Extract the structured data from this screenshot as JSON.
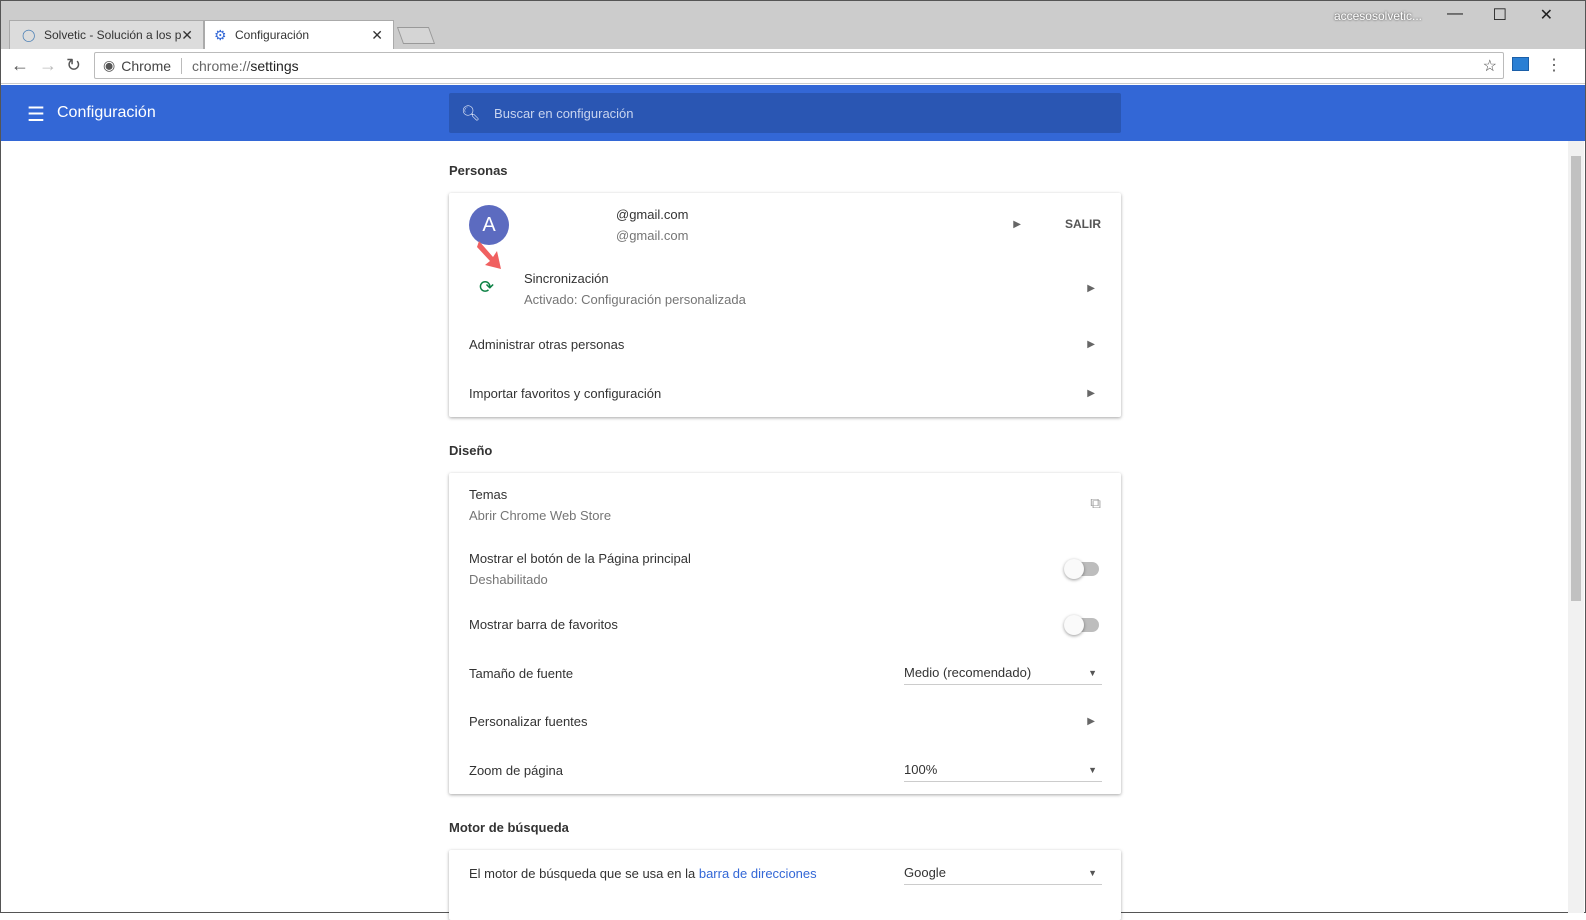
{
  "window": {
    "user": "accesosolvetic...",
    "minimize": "—",
    "maximize": "☐",
    "close": "✕"
  },
  "tabs": [
    {
      "label": "Solvetic - Solución a los p",
      "close": "✕"
    },
    {
      "label": "Configuración",
      "close": "✕"
    }
  ],
  "toolbar": {
    "chip": "Chrome",
    "url_scheme": "chrome://",
    "url_path": "settings"
  },
  "header": {
    "title": "Configuración",
    "search_placeholder": "Buscar en configuración"
  },
  "people": {
    "heading": "Personas",
    "avatar": "A",
    "name": "@gmail.com",
    "email": "@gmail.com",
    "signout": "SALIR",
    "sync_title": "Sincronización",
    "sync_status": "Activado: Configuración personalizada",
    "manage": "Administrar otras personas",
    "import": "Importar favoritos y configuración"
  },
  "design": {
    "heading": "Diseño",
    "themes": "Temas",
    "themes_sub": "Abrir Chrome Web Store",
    "home_button": "Mostrar el botón de la Página principal",
    "home_button_sub": "Deshabilitado",
    "bookmarks_bar": "Mostrar barra de favoritos",
    "font_size": "Tamaño de fuente",
    "font_size_value": "Medio (recomendado)",
    "custom_fonts": "Personalizar fuentes",
    "zoom": "Zoom de página",
    "zoom_value": "100%"
  },
  "search_engine": {
    "heading": "Motor de búsqueda",
    "label": "El motor de búsqueda que se usa en la",
    "link": "barra de direcciones",
    "value": "Google"
  }
}
